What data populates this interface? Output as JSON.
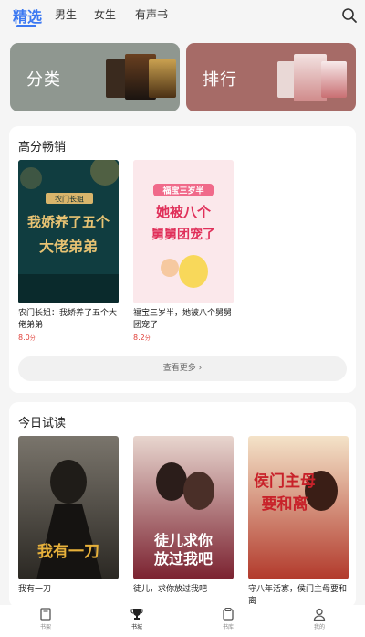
{
  "tabs": [
    {
      "label": "精选",
      "active": true
    },
    {
      "label": "男生"
    },
    {
      "label": "女生"
    },
    {
      "label": "有声书"
    }
  ],
  "banners": {
    "category": {
      "label": "分类",
      "color": "#8f9790"
    },
    "ranking": {
      "label": "排行",
      "color": "#a66b67"
    }
  },
  "section_hot": {
    "title": "高分畅销",
    "books": [
      {
        "title": "农门长姐：我娇养了五个大佬弟弟",
        "score": "8.0",
        "unit": "分",
        "cover_text": [
          "农门长姐",
          "我娇养了五个",
          "大佬弟弟"
        ]
      },
      {
        "title": "福宝三岁半，她被八个舅舅团宠了",
        "score": "8.2",
        "unit": "分",
        "cover_text": [
          "福宝三岁半",
          "她被八个",
          "舅舅团宠了"
        ]
      }
    ],
    "more_label": "查看更多"
  },
  "section_trial": {
    "title": "今日试读",
    "books": [
      {
        "title": "我有一刀",
        "cover_text": [
          "我有一刀"
        ]
      },
      {
        "title": "徒儿，求你放过我吧",
        "cover_text": [
          "徒儿求你",
          "放过我吧"
        ]
      },
      {
        "title": "守八年活寡，侯门主母要和离",
        "cover_text": [
          "侯门主母",
          "要和离"
        ]
      }
    ]
  },
  "bottom_nav": [
    {
      "label": "书架",
      "icon": "book-icon"
    },
    {
      "label": "书城",
      "icon": "trophy-icon",
      "active": true
    },
    {
      "label": "书库",
      "icon": "library-icon"
    },
    {
      "label": "我的",
      "icon": "user-icon"
    }
  ],
  "colors": {
    "accent": "#3b78f2",
    "score": "#e0403a"
  }
}
